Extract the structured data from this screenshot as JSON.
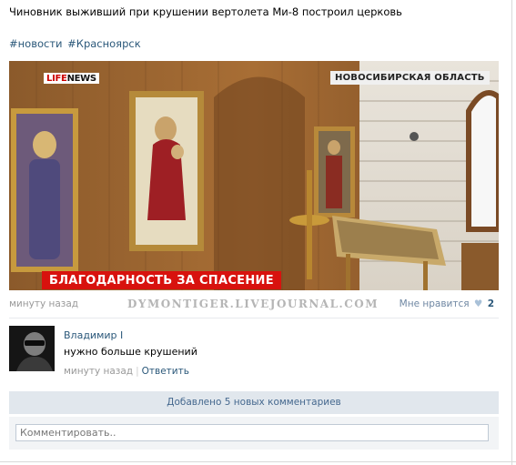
{
  "post": {
    "text": "Чиновник выживший при крушении вертолета Ми-8 построил церковь",
    "hashtags": [
      "#новости",
      "#Красноярск"
    ]
  },
  "video": {
    "channel_life": "LIFE",
    "channel_news": "NEWS",
    "region": "НОВОСИБИРСКАЯ ОБЛАСТЬ",
    "caption": "БЛАГОДАРНОСТЬ ЗА СПАСЕНИЕ"
  },
  "meta": {
    "time": "минуту назад",
    "watermark": "DYMONTIGER.LIVEJOURNAL.COM",
    "likes_label": "Мне нравится",
    "likes_count": "2",
    "heart_icon": "heart-icon"
  },
  "comment": {
    "author": "Владимир I",
    "text": "нужно больше крушений",
    "time": "минуту назад",
    "separator": "|",
    "reply_label": "Ответить"
  },
  "added_comments": "Добавлено 5 новых комментариев",
  "comment_input": {
    "placeholder": "Комментировать.."
  },
  "colors": {
    "link": "#2b587a",
    "caption_red": "#d8120e",
    "bar_bg": "#e1e7ed"
  }
}
